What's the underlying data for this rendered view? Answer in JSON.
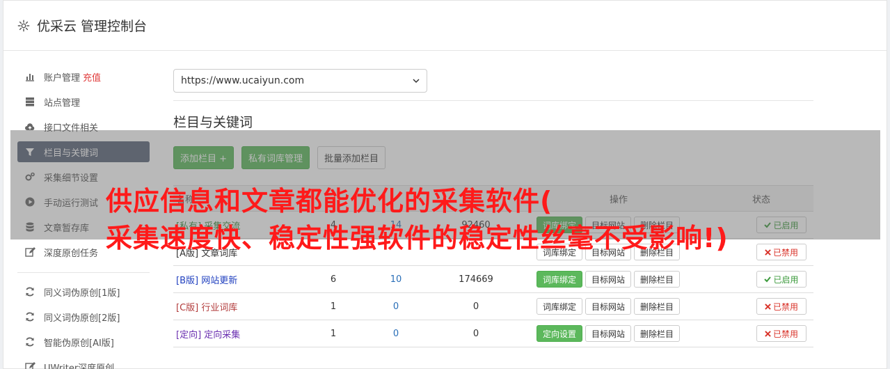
{
  "header": {
    "title": "优采云 管理控制台"
  },
  "sidebar": {
    "items": [
      {
        "label": "账户管理",
        "extra": "充值",
        "icon": "bar-chart-icon"
      },
      {
        "label": "站点管理",
        "icon": "server-icon"
      },
      {
        "label": "接口文件相关",
        "icon": "cloud-upload-icon"
      },
      {
        "label": "栏目与关键词",
        "icon": "filter-icon",
        "active": true
      },
      {
        "label": "采集细节设置",
        "icon": "gears-icon"
      },
      {
        "label": "手动运行测试",
        "icon": "play-circle-icon"
      },
      {
        "label": "文章暂存库",
        "icon": "database-icon"
      },
      {
        "label": "深度原创任务",
        "icon": "edit-icon"
      }
    ],
    "items2": [
      {
        "label": "同义词伪原创[1版]",
        "icon": "refresh-icon"
      },
      {
        "label": "同义词伪原创[2版]",
        "icon": "refresh-icon"
      },
      {
        "label": "智能伪原创[AI版]",
        "icon": "refresh-icon"
      },
      {
        "label": "UWriter深度原创",
        "icon": "edit-icon"
      }
    ]
  },
  "main": {
    "site_select": "https://www.ucaiyun.com",
    "section_title": "栏目与关键词",
    "buttons": {
      "add": "添加栏目 +",
      "private_lib": "私有词库管理",
      "batch_add": "批量添加栏目"
    },
    "table": {
      "headers": {
        "name": "名称",
        "ops": "操作",
        "state": "状态"
      },
      "rows": [
        {
          "tag": "[私有]",
          "name": "采集交流",
          "a": "4",
          "b": "14",
          "c": "92460",
          "op1": "词库绑定",
          "op1_green": true,
          "op2": "目标网站",
          "op3": "删除栏目",
          "state": "已启用",
          "on": true,
          "tagcls": "tag-private"
        },
        {
          "tag": "[A版]",
          "name": "文章词库",
          "a": "",
          "b": "",
          "c": "",
          "op1": "词库绑定",
          "op1_green": false,
          "op2": "目标网站",
          "op3": "删除栏目",
          "state": "已禁用",
          "on": false,
          "tagcls": "tag-a"
        },
        {
          "tag": "[B版]",
          "name": "网站更新",
          "a": "6",
          "b": "10",
          "c": "174669",
          "op1": "词库绑定",
          "op1_green": true,
          "op2": "目标网站",
          "op3": "删除栏目",
          "state": "已启用",
          "on": true,
          "tagcls": "tag-b"
        },
        {
          "tag": "[C版]",
          "name": "行业词库",
          "a": "1",
          "b": "0",
          "c": "0",
          "op1": "词库绑定",
          "op1_green": false,
          "op2": "目标网站",
          "op3": "删除栏目",
          "state": "已禁用",
          "on": false,
          "tagcls": "tag-c"
        },
        {
          "tag": "[定向]",
          "name": "定向采集",
          "a": "1",
          "b": "0",
          "c": "0",
          "op1": "定向设置",
          "op1_green": true,
          "op2": "目标网站",
          "op3": "删除栏目",
          "state": "已禁用",
          "on": false,
          "tagcls": "tag-d"
        }
      ]
    }
  },
  "overlay": {
    "line1": "供应信息和文章都能优化的采集软件(",
    "line2": "采集速度快、稳定性强软件的稳定性丝毫不受影响!)"
  },
  "colors": {
    "green": "#5cb85c",
    "active_side": "#5a6578",
    "overlay_text": "#ff1a1a",
    "recharge": "#e03b3b"
  }
}
